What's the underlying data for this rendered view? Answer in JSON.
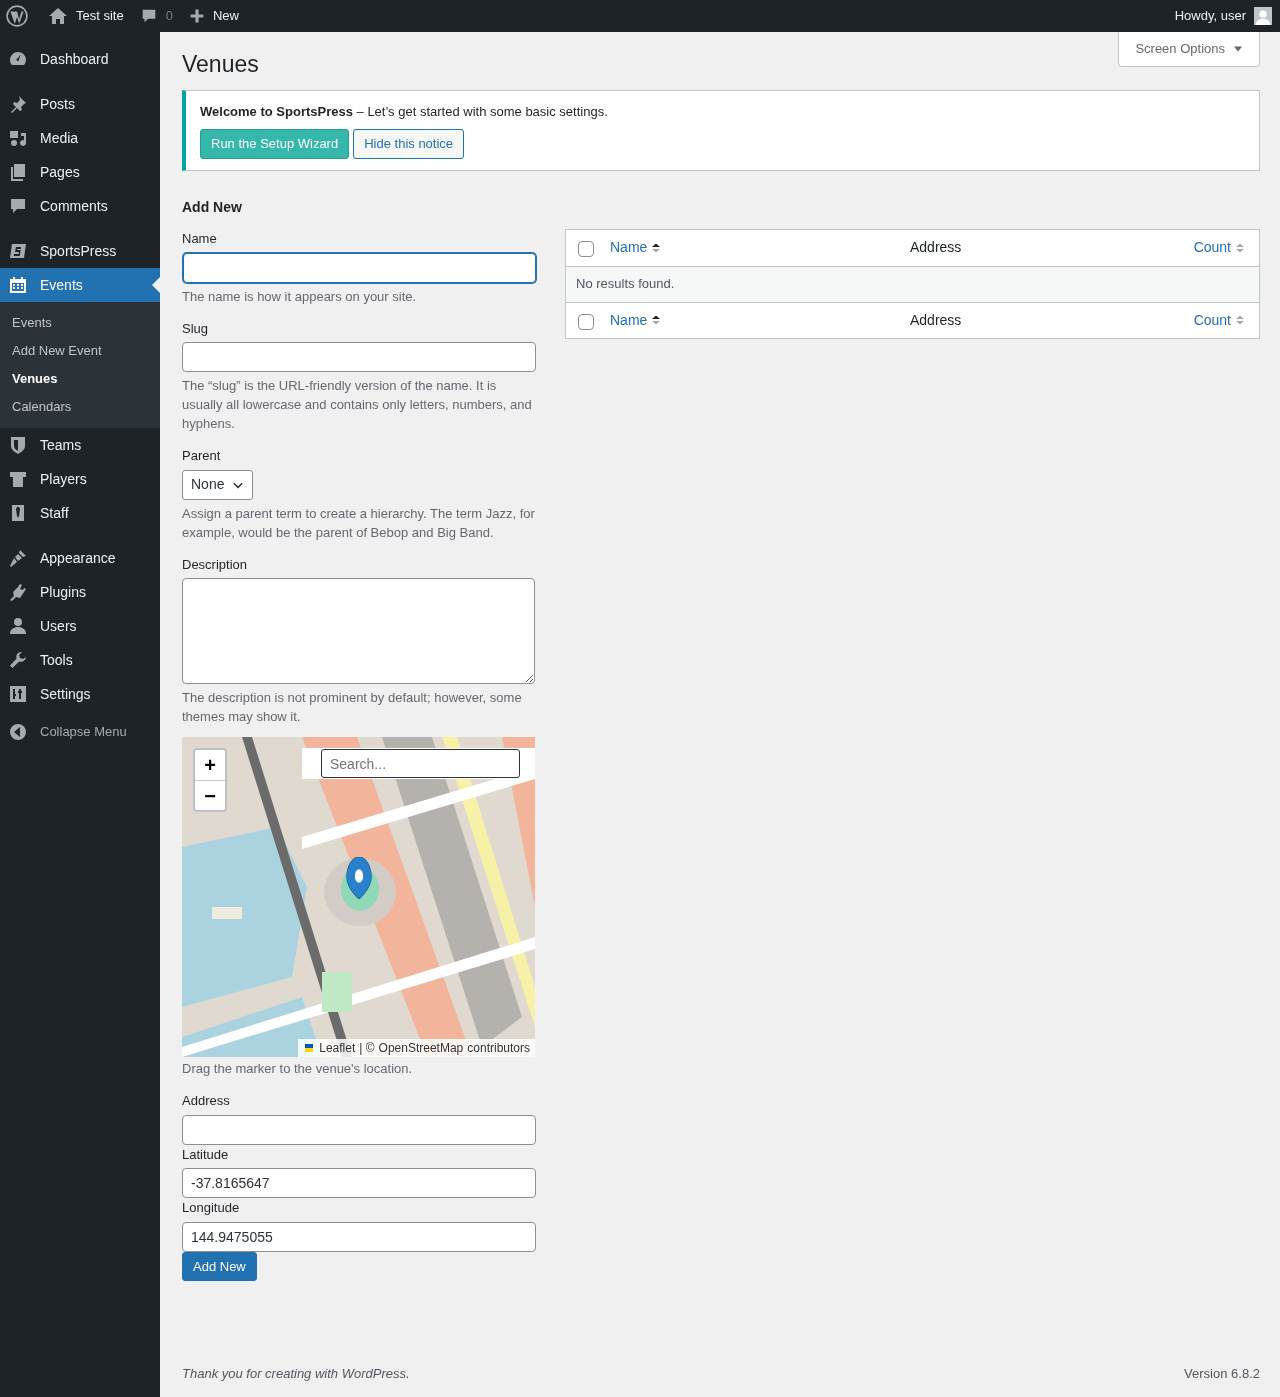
{
  "admin_bar": {
    "site": "Test site",
    "comments": "0",
    "new": "New",
    "greeting": "Howdy, user"
  },
  "menu": [
    [
      {
        "label": "Dashboard",
        "selected": false
      }
    ],
    [
      {
        "label": "Posts",
        "selected": false
      },
      {
        "label": "Media",
        "selected": false
      },
      {
        "label": "Pages",
        "selected": false
      },
      {
        "label": "Comments",
        "selected": false
      }
    ],
    [
      {
        "label": "SportsPress",
        "selected": false
      },
      {
        "label": "Events",
        "selected": true,
        "submenu": [
          {
            "label": "Events",
            "selected": false
          },
          {
            "label": "Add New Event",
            "selected": false
          },
          {
            "label": "Venues",
            "selected": true
          },
          {
            "label": "Calendars",
            "selected": false
          }
        ]
      },
      {
        "label": "Teams",
        "selected": false
      },
      {
        "label": "Players",
        "selected": false
      },
      {
        "label": "Staff",
        "selected": false
      }
    ],
    [
      {
        "label": "Appearance",
        "selected": false
      },
      {
        "label": "Plugins",
        "selected": false
      },
      {
        "label": "Users",
        "selected": false
      },
      {
        "label": "Tools",
        "selected": false
      },
      {
        "label": "Settings",
        "selected": false
      }
    ]
  ],
  "collapse": "Collapse Menu",
  "screen_options": "Screen Options",
  "title": "Venues",
  "notice": {
    "text": "**Welcome to SportsPress** – Let’s get started with some basic settings.",
    "primary": "Run the Setup Wizard",
    "secondary": "Hide this notice"
  },
  "form": {
    "heading": "Add New",
    "fields": [
      {
        "kind": "text",
        "label": "Name",
        "focused": true,
        "description": "The name is how it appears on your site."
      },
      {
        "kind": "text",
        "label": "Slug",
        "focused": false,
        "description": "The “slug” is the URL-friendly version of the name. It is usually all lowercase and contains only letters, numbers, and hyphens."
      },
      {
        "kind": "select",
        "label": "Parent",
        "value": "None",
        "description": "Assign a parent term to create a hierarchy. The term Jazz, for example, would be the parent of Bebop and Big Band."
      },
      {
        "kind": "textarea",
        "label": "Description",
        "description": "The description is not prominent by default; however, some themes may show it."
      },
      {
        "kind": "map",
        "zoom_in": "+",
        "zoom_out": "−",
        "search_placeholder": "Search...",
        "attribution": {
          "link1": "Leaflet",
          "middle": "| ©",
          "link2": "OpenStreetMap",
          "end": "contributors"
        },
        "description": "Drag the marker to the venue's location."
      },
      {
        "kind": "text",
        "label": "Address",
        "focused": false
      },
      {
        "kind": "text",
        "label": "Latitude",
        "value": "-37.8165647",
        "focused": false
      },
      {
        "kind": "text",
        "label": "Longitude",
        "value": "144.9475055",
        "focused": false
      }
    ],
    "submit": "Add New"
  },
  "table": {
    "header_columns": [
      {
        "label": "Name",
        "sortable": true,
        "sorted": true,
        "checked": false
      },
      {
        "label": "Address",
        "sortable": false
      },
      {
        "label": "Count",
        "sortable": true,
        "sorted": false
      }
    ],
    "empty_message": "No results found.",
    "footer_columns": [
      {
        "label": "Name",
        "sortable": true,
        "sorted": true,
        "checked": false
      },
      {
        "label": "Address",
        "sortable": false
      },
      {
        "label": "Count",
        "sortable": true,
        "sorted": false
      }
    ]
  },
  "footer": {
    "before": "Thank you for creating with ",
    "link": "WordPress",
    "after": ".",
    "version": "Version 6.8.2"
  }
}
